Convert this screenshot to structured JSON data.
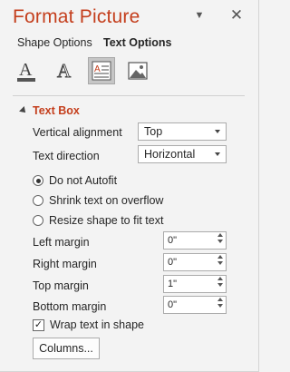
{
  "pane": {
    "title": "Format Picture",
    "dropdown_icon": "triangle-down",
    "close_icon": "close-x"
  },
  "tabs": {
    "shape_options": "Shape Options",
    "text_options": "Text Options"
  },
  "icons": [
    "text-fill-outline-icon",
    "text-effects-icon",
    "textbox-icon",
    "picture-icon"
  ],
  "section": {
    "title": "Text Box"
  },
  "vertical_alignment": {
    "label": "Vertical alignment",
    "value": "Top"
  },
  "text_direction": {
    "label": "Text direction",
    "value": "Horizontal"
  },
  "autofit": {
    "do_not": "Do not Autofit",
    "shrink": "Shrink text on overflow",
    "resize": "Resize shape to fit text",
    "selected": "do_not"
  },
  "margins": {
    "left": {
      "label": "Left margin",
      "value": "0\""
    },
    "right": {
      "label": "Right margin",
      "value": "0\""
    },
    "top": {
      "label": "Top margin",
      "value": "1\""
    },
    "bottom": {
      "label": "Bottom margin",
      "value": "0\""
    }
  },
  "wrap": {
    "label": "Wrap text in shape",
    "checked": true
  },
  "columns_button": "Columns...",
  "colors": {
    "accent": "#c43e1c"
  }
}
